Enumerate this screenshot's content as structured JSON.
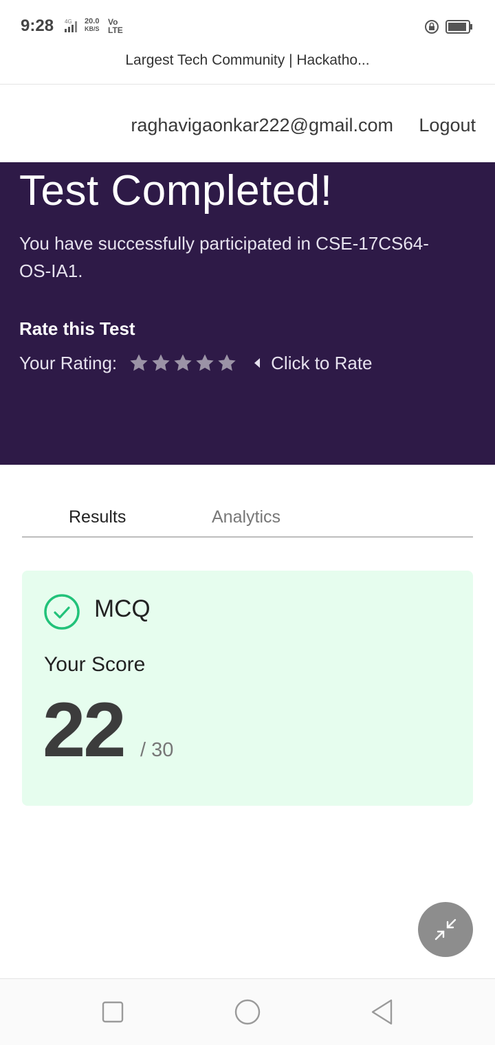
{
  "status_bar": {
    "time": "9:28",
    "network": "4G",
    "speed_value": "20.0",
    "speed_unit": "KB/S",
    "volte_top": "Vo",
    "volte_bottom": "LTE"
  },
  "browser": {
    "page_title": "Largest Tech Community | Hackatho..."
  },
  "header": {
    "user_email": "raghavigaonkar222@gmail.com",
    "logout_label": "Logout"
  },
  "hero": {
    "title": "Test Completed!",
    "description": "You have successfully participated in CSE-17CS64-OS-IA1.",
    "rate_heading": "Rate this Test",
    "rating_label": "Your Rating:",
    "rating_hint": "Click to Rate",
    "star_color": "#9b93a6",
    "background_color": "#2e1a47"
  },
  "tabs": [
    {
      "label": "Results",
      "active": true
    },
    {
      "label": "Analytics",
      "active": false
    }
  ],
  "score_card": {
    "section_type": "MCQ",
    "score_label": "Your Score",
    "score": "22",
    "total": "/ 30",
    "background_color": "#e6fdee",
    "check_color": "#22c27a"
  },
  "fab": {
    "icon": "minimize-arrows-icon"
  },
  "nav_bar": {
    "buttons": [
      "recent-apps-icon",
      "home-icon",
      "back-icon"
    ]
  }
}
